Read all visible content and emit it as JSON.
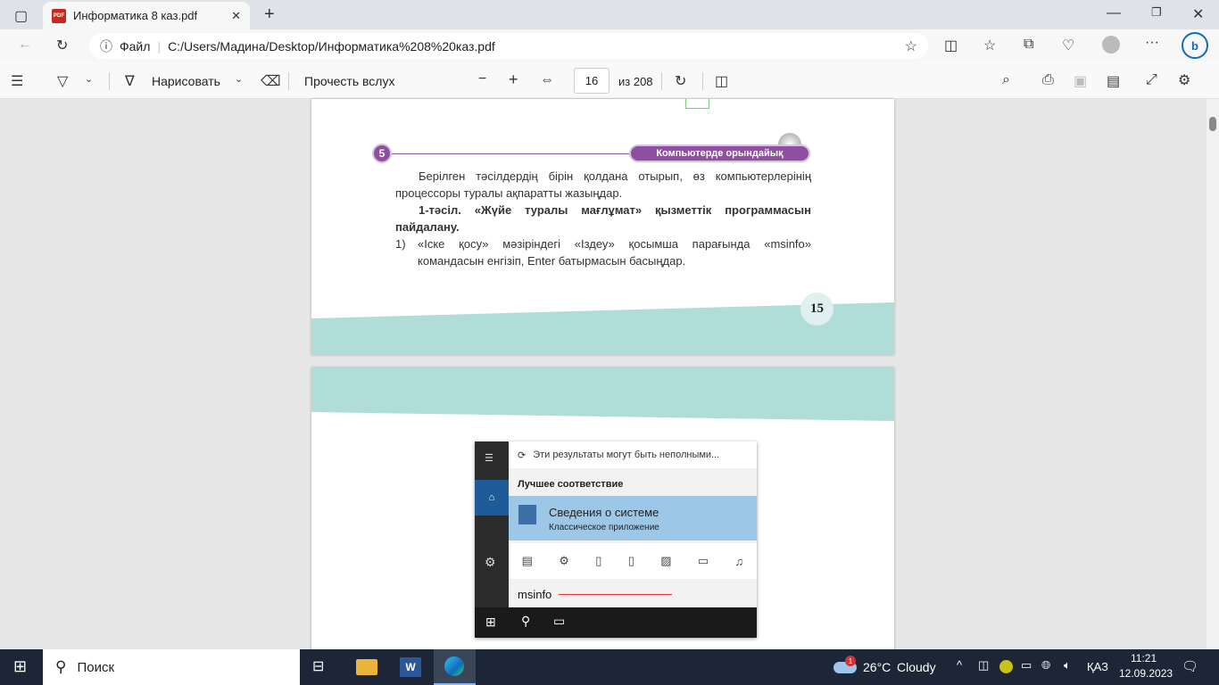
{
  "browser": {
    "tab_title": "Информатика 8 каз.pdf",
    "url_prefix": "Файл",
    "url": "C:/Users/Мадина/Desktop/Информатика%208%20каз.pdf"
  },
  "toolbar": {
    "draw_label": "Нарисовать",
    "read_aloud_label": "Прочесть вслух",
    "page_current": "16",
    "page_total": "из 208"
  },
  "page1": {
    "section_number": "5",
    "section_title": "Компьютерде орындайық",
    "para1": "Берілген тәсілдердің бірін қолдана отырып, өз компьютерлерінің процессоры туралы ақпаратты жазыңдар.",
    "method_title": "1-тәсіл. «Жүйе туралы мағлұмат» қызметтік программасын пайдалану.",
    "step1_num": "1)",
    "step1_text": "«Іске қосу» мәзіріндегі «Іздеу» қосымша парағында «msinfo» командасын енгізіп, Enter батырмасын басыңдар.",
    "page_number": "15"
  },
  "screenshot": {
    "notice": "Эти результаты могут быть неполными...",
    "best_match": "Лучшее соответствие",
    "app_name": "Сведения о системе",
    "app_type": "Классическое приложение",
    "query": "msinfo"
  },
  "taskbar": {
    "search_label": "Поиск",
    "weather_badge": "1",
    "temperature": "26°C",
    "weather": "Cloudy",
    "language": "ҚАЗ",
    "time": "11:21",
    "date": "12.09.2023"
  },
  "colors": {
    "accent_purple": "#8e4fa0",
    "teal": "#b0ddd8",
    "edge_blue": "#0f6cbd"
  }
}
